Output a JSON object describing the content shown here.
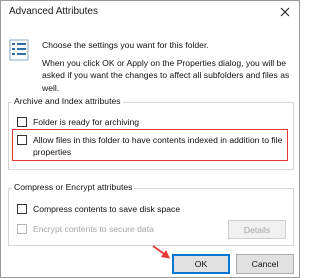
{
  "window": {
    "title": "Advanced Attributes",
    "close_icon": "close-icon",
    "info_icon": "settings-list-icon"
  },
  "intro": {
    "line1": "Choose the settings you want for this folder.",
    "line2": "When you click OK or Apply on the Properties dialog, you will be asked if you want the changes to affect all subfolders and files as well."
  },
  "archive_group": {
    "label": "Archive and Index attributes",
    "items": [
      {
        "label": "Folder is ready for archiving",
        "checked": false
      },
      {
        "label": "Allow files in this folder to have contents indexed in addition to file properties",
        "checked": false
      }
    ]
  },
  "compress_group": {
    "label": "Compress or Encrypt attributes",
    "items": [
      {
        "label": "Compress contents to save disk space",
        "checked": false
      },
      {
        "label": "Encrypt contents to secure data",
        "checked": false,
        "disabled": true
      }
    ],
    "details_label": "Details"
  },
  "footer": {
    "ok_label": "OK",
    "cancel_label": "Cancel"
  },
  "colors": {
    "highlight": "#e53935",
    "accent": "#0078d7"
  }
}
